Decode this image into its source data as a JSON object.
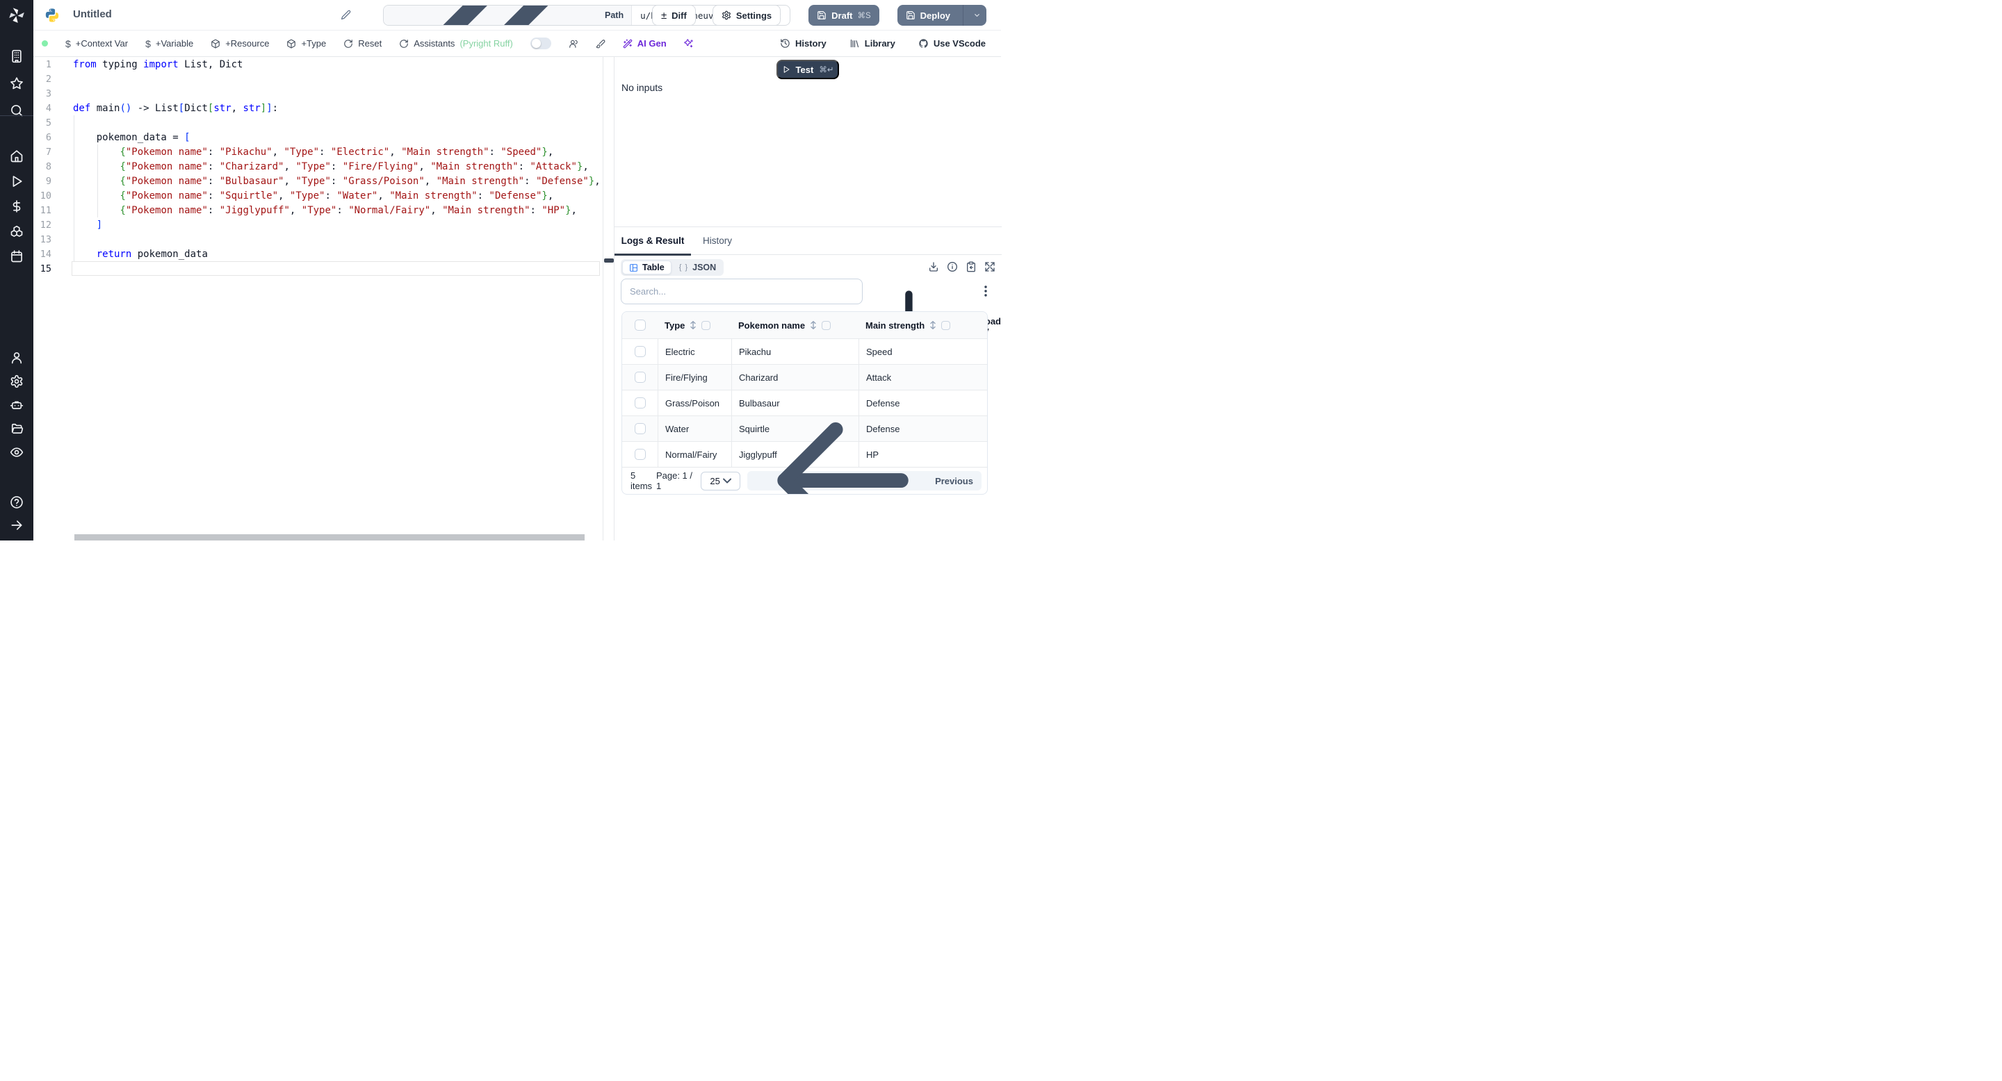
{
  "topbar": {
    "title": "Untitled",
    "path_label": "Path",
    "path_value": "u/henri/maneuverable_script",
    "diff_label": "Diff",
    "settings_label": "Settings",
    "draft_label": "Draft",
    "draft_shortcut": "⌘S",
    "deploy_label": "Deploy"
  },
  "toolbar": {
    "left_items": [
      {
        "type": "dot"
      },
      {
        "type": "item",
        "icon": "dollar-icon",
        "label": "+Context Var"
      },
      {
        "type": "item",
        "icon": "dollar-icon",
        "label": "+Variable"
      },
      {
        "type": "item",
        "icon": "package-icon",
        "label": "+Resource"
      },
      {
        "type": "item",
        "icon": "package-icon",
        "label": "+Type"
      },
      {
        "type": "item",
        "icon": "rotate-icon",
        "label": "Reset"
      },
      {
        "type": "item",
        "icon": "rotate-icon",
        "label": "Assistants",
        "suffix": "(Pyright Ruff)"
      },
      {
        "type": "toggle"
      },
      {
        "type": "item",
        "icon": "users-icon",
        "label": ""
      },
      {
        "type": "item",
        "icon": "brush-icon",
        "label": ""
      },
      {
        "type": "item",
        "icon": "wand-icon",
        "label": "AI Gen",
        "accent": true
      },
      {
        "type": "item",
        "icon": "sparkles-icon",
        "label": "",
        "accent": true
      }
    ],
    "right_items": [
      {
        "icon": "clock-history-icon",
        "label": "History"
      },
      {
        "icon": "library-icon",
        "label": "Library"
      },
      {
        "icon": "github-icon",
        "label": "Use VScode"
      }
    ]
  },
  "sidebar": {
    "top": [
      "building-icon",
      "star-icon",
      "search-icon"
    ],
    "main": [
      "home-icon",
      "play-icon",
      "dollar-icon",
      "boxes-icon",
      "calendar-icon"
    ],
    "admin": [
      "user-icon",
      "gear-icon",
      "robot-icon",
      "folder-icon",
      "eye-icon"
    ],
    "foot": [
      "help-icon",
      "arrow-right-icon"
    ]
  },
  "editor": {
    "active_line": 15,
    "lines": [
      [
        [
          "k",
          "from"
        ],
        [
          "p",
          " typing "
        ],
        [
          "k",
          "import"
        ],
        [
          "p",
          " List, Dict"
        ]
      ],
      [],
      [],
      [
        [
          "k",
          "def"
        ],
        [
          "p",
          " main"
        ],
        [
          "b1",
          "()"
        ],
        [
          "p",
          " -> List"
        ],
        [
          "b1",
          "["
        ],
        [
          "p",
          "Dict"
        ],
        [
          "b2",
          "["
        ],
        [
          "k",
          "str"
        ],
        [
          "p",
          ", "
        ],
        [
          "k",
          "str"
        ],
        [
          "b2",
          "]"
        ],
        [
          "b1",
          "]"
        ],
        [
          "p",
          ":"
        ]
      ],
      [],
      [
        [
          "p",
          "    pokemon_data = "
        ],
        [
          "b1",
          "["
        ]
      ],
      [
        [
          "p",
          "        "
        ],
        [
          "b2",
          "{"
        ],
        [
          "s",
          "\"Pokemon name\""
        ],
        [
          "p",
          ": "
        ],
        [
          "s",
          "\"Pikachu\""
        ],
        [
          "p",
          ", "
        ],
        [
          "s",
          "\"Type\""
        ],
        [
          "p",
          ": "
        ],
        [
          "s",
          "\"Electric\""
        ],
        [
          "p",
          ", "
        ],
        [
          "s",
          "\"Main strength\""
        ],
        [
          "p",
          ": "
        ],
        [
          "s",
          "\"Speed\""
        ],
        [
          "b2",
          "}"
        ],
        [
          "p",
          ","
        ]
      ],
      [
        [
          "p",
          "        "
        ],
        [
          "b2",
          "{"
        ],
        [
          "s",
          "\"Pokemon name\""
        ],
        [
          "p",
          ": "
        ],
        [
          "s",
          "\"Charizard\""
        ],
        [
          "p",
          ", "
        ],
        [
          "s",
          "\"Type\""
        ],
        [
          "p",
          ": "
        ],
        [
          "s",
          "\"Fire/Flying\""
        ],
        [
          "p",
          ", "
        ],
        [
          "s",
          "\"Main strength\""
        ],
        [
          "p",
          ": "
        ],
        [
          "s",
          "\"Attack\""
        ],
        [
          "b2",
          "}"
        ],
        [
          "p",
          ","
        ]
      ],
      [
        [
          "p",
          "        "
        ],
        [
          "b2",
          "{"
        ],
        [
          "s",
          "\"Pokemon name\""
        ],
        [
          "p",
          ": "
        ],
        [
          "s",
          "\"Bulbasaur\""
        ],
        [
          "p",
          ", "
        ],
        [
          "s",
          "\"Type\""
        ],
        [
          "p",
          ": "
        ],
        [
          "s",
          "\"Grass/Poison\""
        ],
        [
          "p",
          ", "
        ],
        [
          "s",
          "\"Main strength\""
        ],
        [
          "p",
          ": "
        ],
        [
          "s",
          "\"Defense\""
        ],
        [
          "b2",
          "}"
        ],
        [
          "p",
          ","
        ]
      ],
      [
        [
          "p",
          "        "
        ],
        [
          "b2",
          "{"
        ],
        [
          "s",
          "\"Pokemon name\""
        ],
        [
          "p",
          ": "
        ],
        [
          "s",
          "\"Squirtle\""
        ],
        [
          "p",
          ", "
        ],
        [
          "s",
          "\"Type\""
        ],
        [
          "p",
          ": "
        ],
        [
          "s",
          "\"Water\""
        ],
        [
          "p",
          ", "
        ],
        [
          "s",
          "\"Main strength\""
        ],
        [
          "p",
          ": "
        ],
        [
          "s",
          "\"Defense\""
        ],
        [
          "b2",
          "}"
        ],
        [
          "p",
          ","
        ]
      ],
      [
        [
          "p",
          "        "
        ],
        [
          "b2",
          "{"
        ],
        [
          "s",
          "\"Pokemon name\""
        ],
        [
          "p",
          ": "
        ],
        [
          "s",
          "\"Jigglypuff\""
        ],
        [
          "p",
          ", "
        ],
        [
          "s",
          "\"Type\""
        ],
        [
          "p",
          ": "
        ],
        [
          "s",
          "\"Normal/Fairy\""
        ],
        [
          "p",
          ", "
        ],
        [
          "s",
          "\"Main strength\""
        ],
        [
          "p",
          ": "
        ],
        [
          "s",
          "\"HP\""
        ],
        [
          "b2",
          "}"
        ],
        [
          "p",
          ","
        ]
      ],
      [
        [
          "p",
          "    "
        ],
        [
          "b1",
          "]"
        ]
      ],
      [],
      [
        [
          "p",
          "    "
        ],
        [
          "k",
          "return"
        ],
        [
          "p",
          " pokemon_data"
        ]
      ],
      []
    ]
  },
  "runner": {
    "test_label": "Test",
    "test_shortcut": "⌘↵",
    "no_inputs": "No inputs"
  },
  "results": {
    "tabs": {
      "logs": "Logs & Result",
      "history": "History"
    },
    "view_toggle": {
      "table": "Table",
      "json": "JSON",
      "braces": "{ }"
    },
    "search_placeholder": "Search...",
    "download_csv": "Download as CSV",
    "table": {
      "columns": [
        "Type",
        "Pokemon name",
        "Main strength"
      ],
      "rows": [
        {
          "type": "Electric",
          "name": "Pikachu",
          "strength": "Speed"
        },
        {
          "type": "Fire/Flying",
          "name": "Charizard",
          "strength": "Attack"
        },
        {
          "type": "Grass/Poison",
          "name": "Bulbasaur",
          "strength": "Defense"
        },
        {
          "type": "Water",
          "name": "Squirtle",
          "strength": "Defense"
        },
        {
          "type": "Normal/Fairy",
          "name": "Jigglypuff",
          "strength": "HP"
        }
      ]
    },
    "footer": {
      "count": "5 items",
      "page": "Page: 1 / 1",
      "page_size": "25",
      "previous": "Previous"
    }
  },
  "colors": {
    "accent_blue": "#3b82f6",
    "accent_violet": "#6d28d9",
    "button_slate": "#64748b",
    "test_navy": "#334155",
    "green_dot": "#86efac",
    "assistant_green": "#86d3a2",
    "code_keyword": "#0000ff",
    "code_string": "#a31515",
    "bracket_level1": "#0431fa",
    "bracket_level2": "#319331",
    "sidebar_bg": "#1b1f28"
  }
}
